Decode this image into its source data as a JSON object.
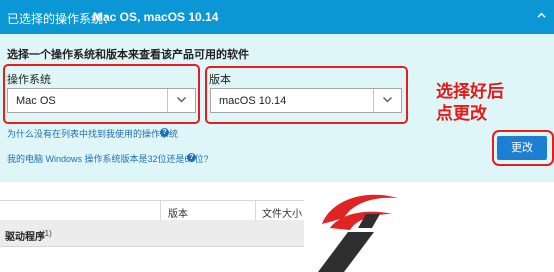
{
  "header": {
    "label": "已选择的操作系统：",
    "value": "Mac OS, macOS 10.14"
  },
  "panel": {
    "prompt": "选择一个操作系统和版本来查看该产品可用的软件",
    "os_label": "操作系统",
    "os_value": "Mac OS",
    "version_label": "版本",
    "version_value": "macOS 10.14",
    "link_missing_os": "为什么没有在列表中找到我使用的操作系统",
    "link_bitness": "我的电脑 Windows 操作系统版本是32位还是64位?",
    "change_button": "更改"
  },
  "annotation": {
    "line1": "选择好后",
    "line2": "点更改",
    "color": "#e51d1d"
  },
  "table": {
    "col_version": "版本",
    "col_size": "文件大小",
    "group_title": "驱动程序",
    "group_count": "(1)"
  },
  "colors": {
    "header_bg": "#0b96d6",
    "panel_bg": "#dff6f8",
    "button_bg": "#1c7fd1",
    "link": "#1f6fb5"
  }
}
